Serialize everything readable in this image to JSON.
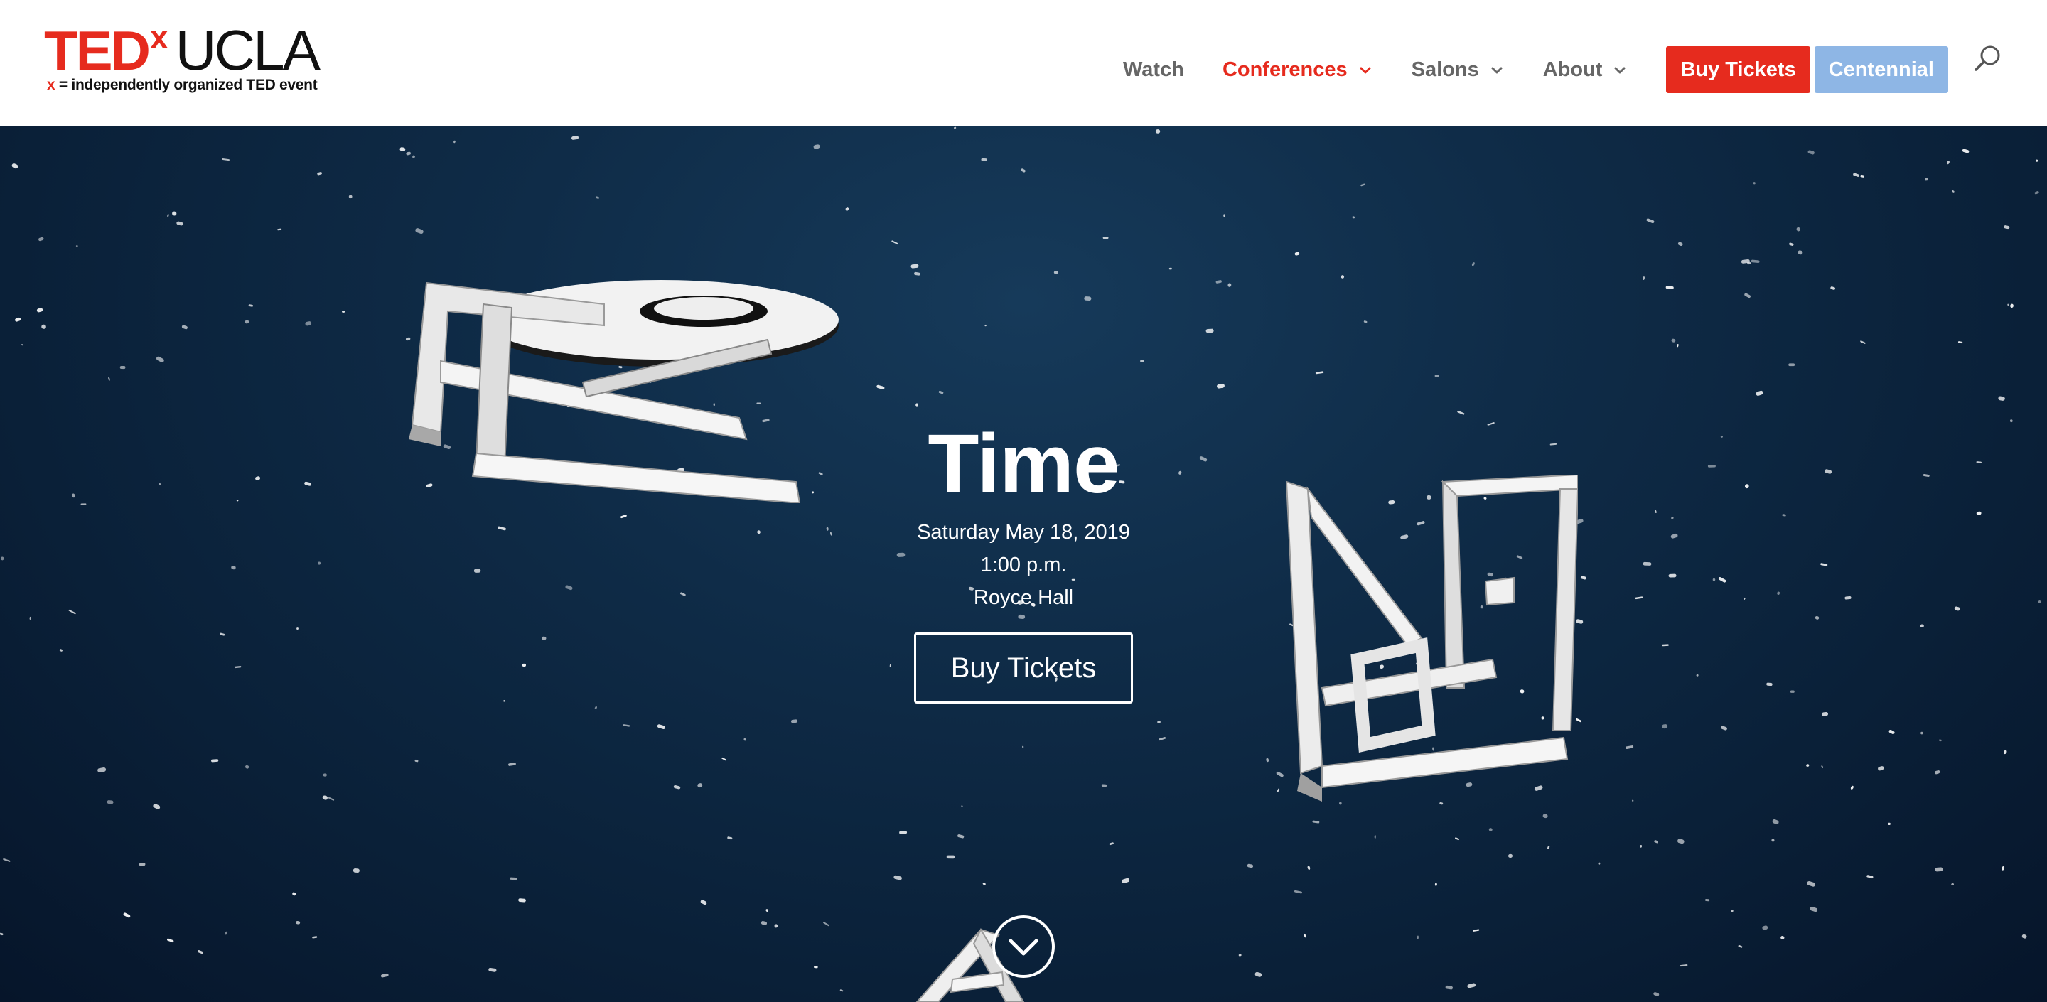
{
  "brand": {
    "logo_ted": "TED",
    "logo_x": "x",
    "logo_name": "UCLA",
    "tagline_x": "x",
    "tagline_rest": " = independently organized TED event",
    "accent_color": "#e62b1e"
  },
  "nav": {
    "items": [
      {
        "label": "Watch",
        "dropdown": false,
        "active": false
      },
      {
        "label": "Conferences",
        "dropdown": true,
        "active": true
      },
      {
        "label": "Salons",
        "dropdown": true,
        "active": false
      },
      {
        "label": "About",
        "dropdown": true,
        "active": false
      }
    ],
    "buy_tickets_label": "Buy Tickets",
    "centennial_label": "Centennial",
    "buy_color": "#e62b1e",
    "centennial_color": "#8eb6e5",
    "search_icon": "search-icon"
  },
  "hero": {
    "title": "Time",
    "date": "Saturday May 18, 2019",
    "time": "1:00 p.m.",
    "venue": "Royce Hall",
    "cta_label": "Buy Tickets",
    "scroll_icon": "chevron-down-circle-icon",
    "background_color": "#0f2c48"
  }
}
